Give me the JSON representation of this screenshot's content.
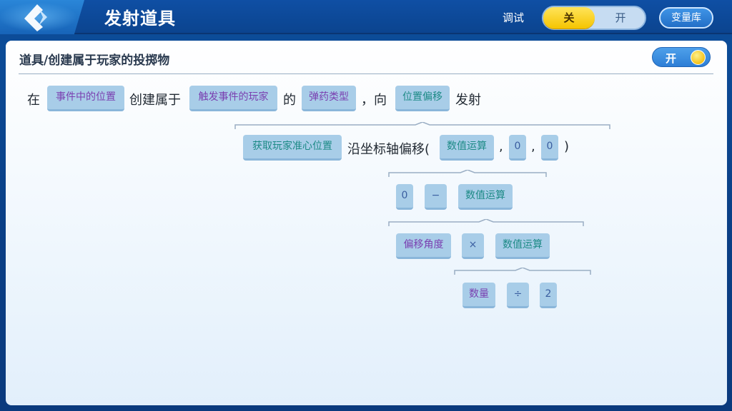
{
  "header": {
    "title": "发射道具",
    "debug_label": "调试",
    "debug_off": "关",
    "debug_on": "开",
    "variable_library": "变量库"
  },
  "panel": {
    "title": "道具/创建属于玩家的投掷物",
    "switch_label": "开"
  },
  "statement": {
    "w_at": "在",
    "chip_event_position": "事件中的位置",
    "w_create": "创建属于",
    "chip_trigger_player": "触发事件的玩家",
    "w_of": "的",
    "chip_ammo_type": "弹药类型",
    "w_to": "，向",
    "chip_offset": "位置偏移",
    "w_fire": "发射"
  },
  "offset_expr": {
    "chip_crosshair": "获取玩家准心位置",
    "w_along": "沿坐标轴偏移(",
    "chip_math1": "数值运算",
    "comma1": ",",
    "chip_zero1": "0",
    "comma2": ",",
    "chip_zero2": "0",
    "close_paren": ")"
  },
  "math1_expr": {
    "chip_zero": "0",
    "chip_minus": "−",
    "chip_math2": "数值运算"
  },
  "math2_expr": {
    "chip_angle": "偏移角度",
    "chip_times": "×",
    "chip_math3": "数值运算"
  },
  "math3_expr": {
    "chip_count": "数量",
    "chip_divide": "÷",
    "chip_two": "2"
  },
  "colors": {
    "chip_bg": "#a8cde8",
    "purple_text": "#7a3fb0",
    "teal_text": "#1d8a86",
    "accent_yellow": "#f5c400"
  }
}
